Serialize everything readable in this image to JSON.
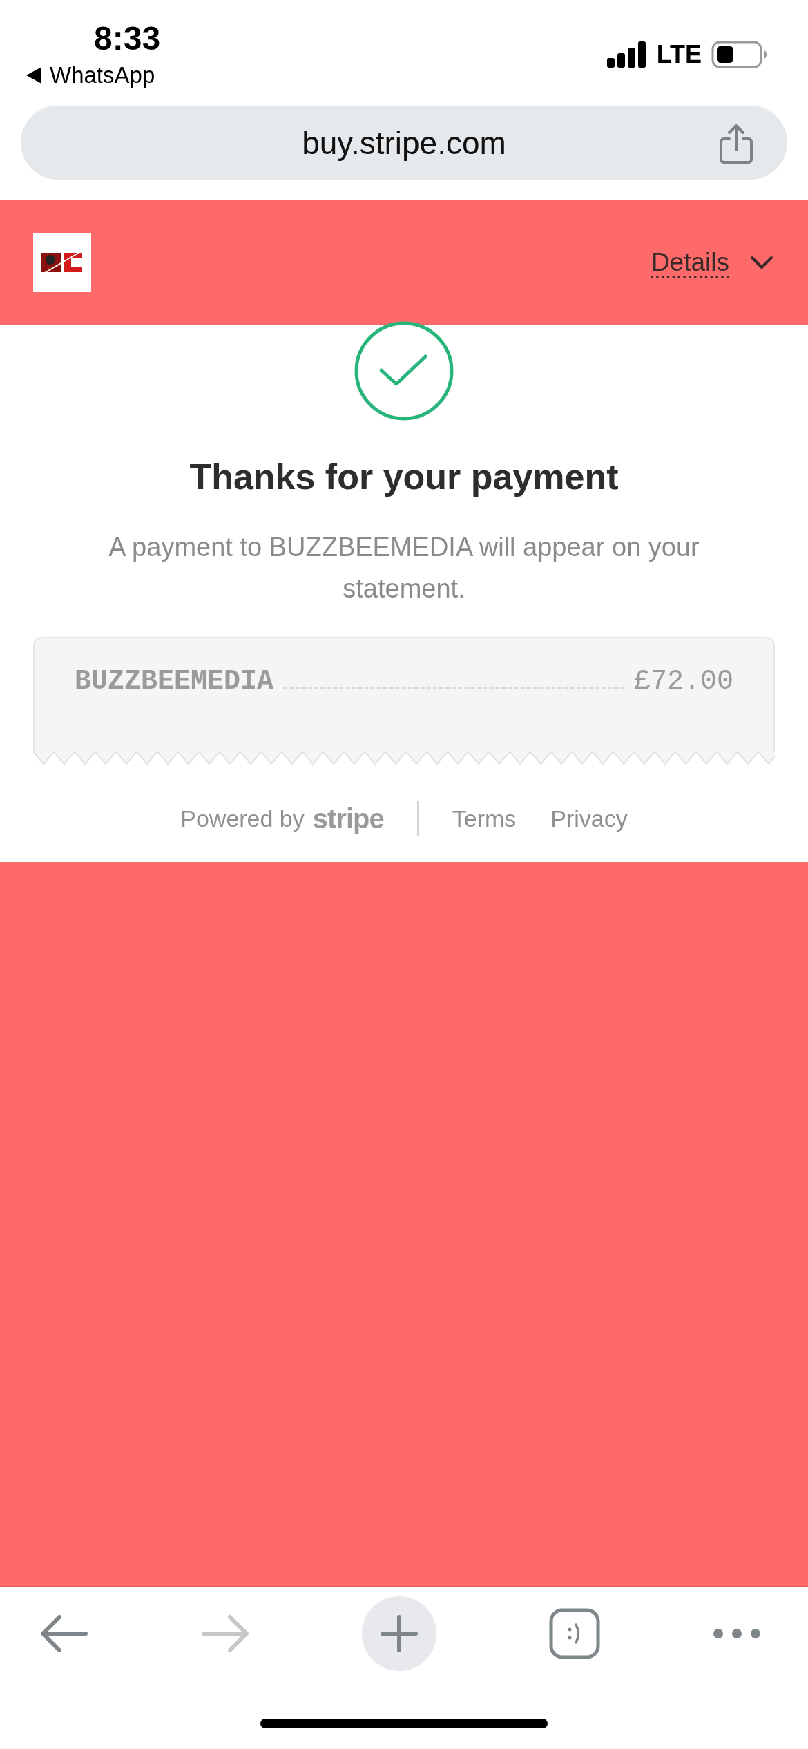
{
  "status_bar": {
    "time": "8:33",
    "back_app": "WhatsApp",
    "network": "LTE"
  },
  "address_bar": {
    "url": "buy.stripe.com"
  },
  "header": {
    "details_link": "Details"
  },
  "confirmation": {
    "title": "Thanks for your payment",
    "message": "A payment to BUZZBEEMEDIA will appear on your statement."
  },
  "receipt": {
    "merchant": "BUZZBEEMEDIA",
    "amount": "£72.00"
  },
  "footer": {
    "powered_by": "Powered by",
    "brand": "stripe",
    "links": [
      "Terms",
      "Privacy"
    ]
  },
  "toolbar": {
    "back_disabled": false,
    "forward_disabled": true
  }
}
